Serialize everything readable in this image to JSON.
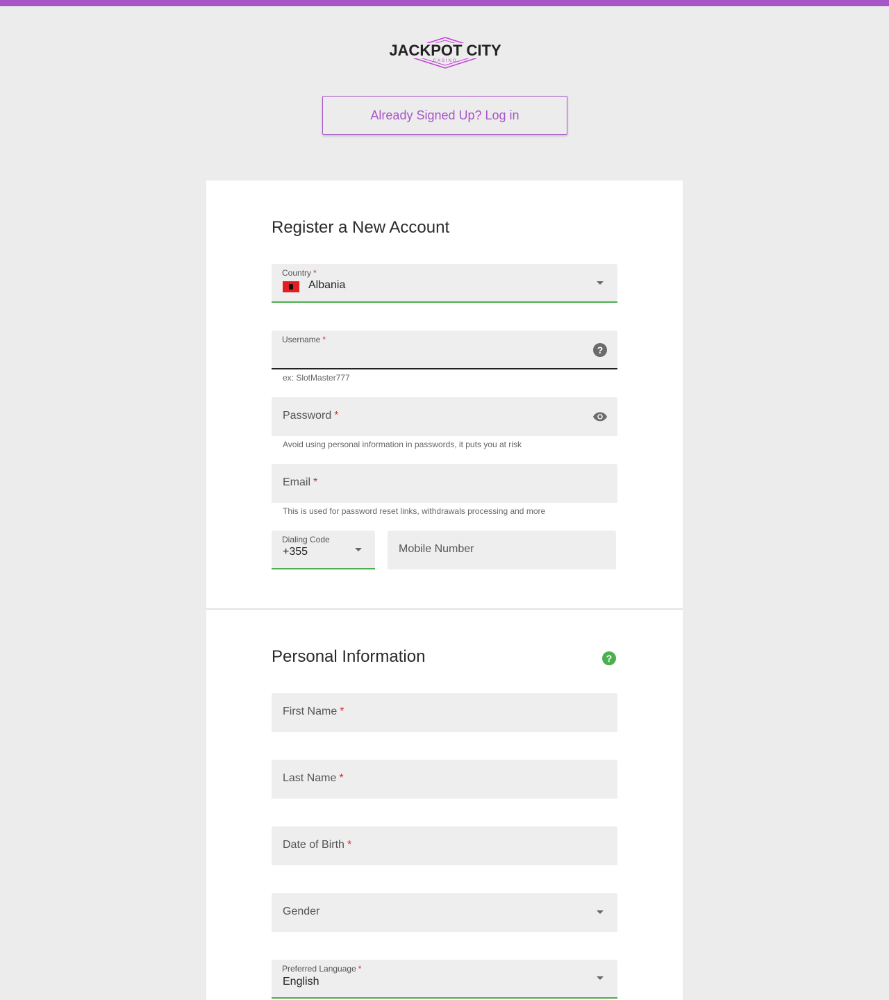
{
  "brand": {
    "name": "JACKPOT CITY",
    "sub": "CASINO",
    "accent": "#a855c8"
  },
  "header": {
    "login_button": "Already Signed Up? Log in"
  },
  "register": {
    "title": "Register a New Account",
    "country": {
      "label": "Country",
      "required": "*",
      "value": "Albania",
      "flag": "albania-flag"
    },
    "username": {
      "label": "Username",
      "required": "*",
      "helper": "ex: SlotMaster777",
      "icon": "help-icon"
    },
    "password": {
      "label": "Password",
      "required": "*",
      "helper": "Avoid using personal information in passwords, it puts you at risk",
      "icon": "eye-icon"
    },
    "email": {
      "label": "Email",
      "required": "*",
      "helper": "This is used for password reset links, withdrawals processing and more"
    },
    "dialing": {
      "label": "Dialing Code",
      "value": "+355"
    },
    "mobile": {
      "placeholder": "Mobile Number"
    }
  },
  "personal": {
    "title": "Personal Information",
    "help_icon_color": "#4caf50",
    "first_name": {
      "label": "First Name",
      "required": "*"
    },
    "last_name": {
      "label": "Last Name",
      "required": "*"
    },
    "dob": {
      "label": "Date of Birth",
      "required": "*"
    },
    "gender": {
      "label": "Gender"
    },
    "language": {
      "label": "Preferred Language",
      "required": "*",
      "value": "English"
    }
  }
}
